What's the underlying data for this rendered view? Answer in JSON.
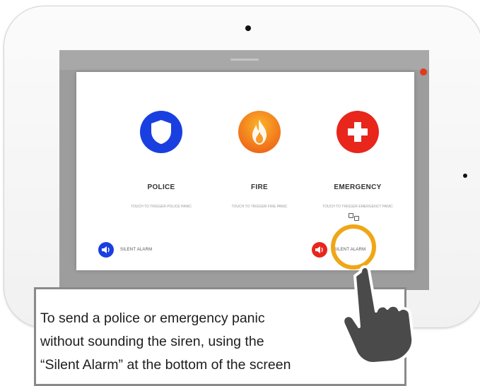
{
  "panic_options": [
    {
      "name": "POLICE",
      "description": "TOUCH TO TRIGGER POLICE PANIC",
      "icon": "shield-icon",
      "color": "#1a3fe0"
    },
    {
      "name": "FIRE",
      "description": "TOUCH TO TRIGGER FIRE PANIC",
      "icon": "flame-icon",
      "color": "#f0701a"
    },
    {
      "name": "EMERGENCY",
      "description": "TOUCH TO TRIGGER EMERGENCY PANIC",
      "icon": "medical-cross-icon",
      "color": "#e8261c"
    }
  ],
  "silent_alarm": {
    "police_label": "SILENT ALARM",
    "emergency_label": "SILENT ALARM"
  },
  "callout": {
    "line1": "To send a police or emergency panic",
    "line2": "without sounding the siren, using the",
    "line3": "“Silent Alarm” at the bottom of the screen"
  },
  "colors": {
    "highlight": "#f0a617",
    "hand": "#4a4a4a"
  }
}
